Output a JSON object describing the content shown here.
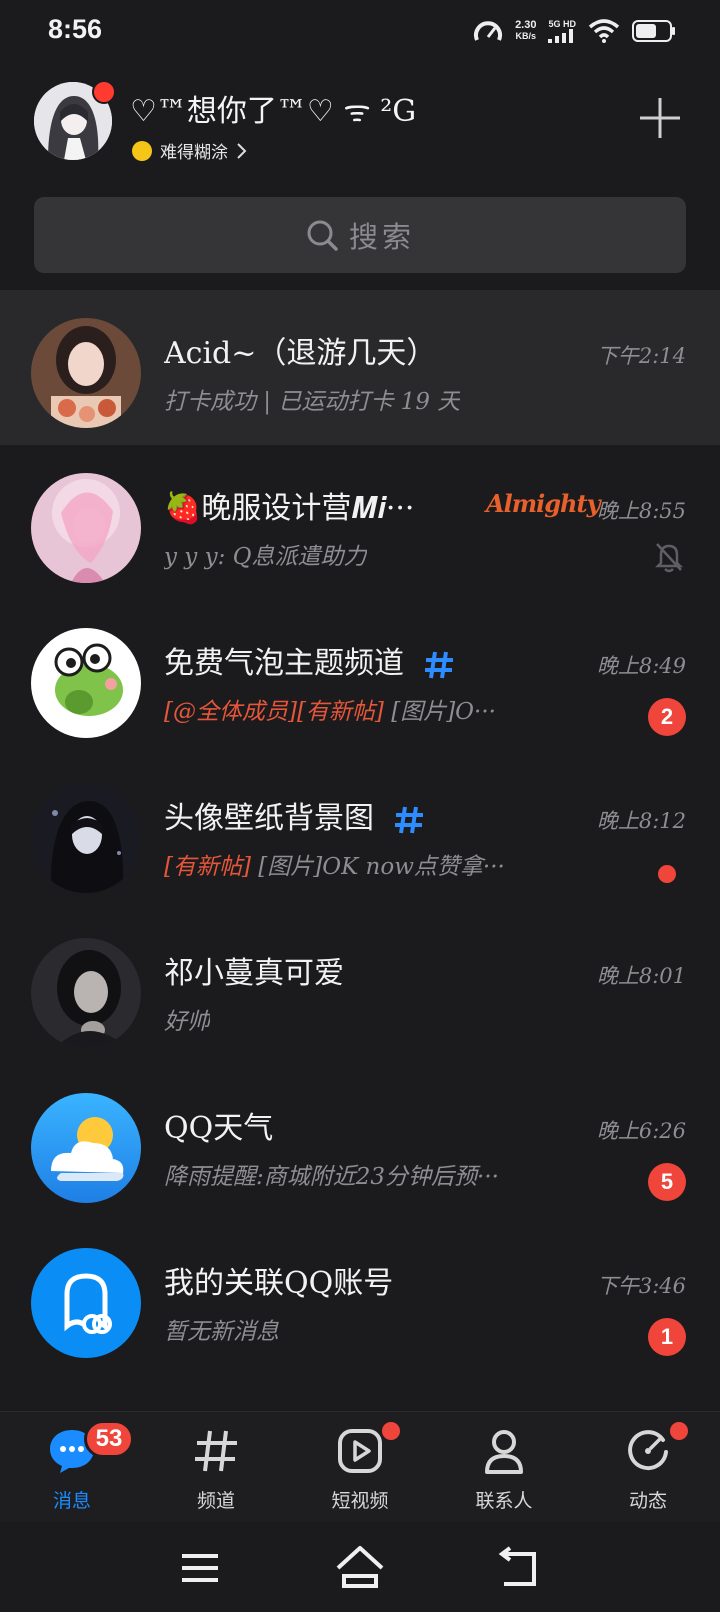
{
  "status_bar": {
    "time": "8:56",
    "net_speed": "2.30",
    "net_unit": "KB/s",
    "net_type": "5G HD"
  },
  "header": {
    "nickname": "♡™想你了™♡ ᯤ ²G",
    "status_text": "难得糊涂"
  },
  "search": {
    "label": "搜索"
  },
  "chats": [
    {
      "name": "Acid~（退游几天）",
      "time": "下午2:14",
      "preview": "打卡成功 | 已运动打卡 19 天"
    },
    {
      "name": "🍓晚服设计营𝑴𝒊···",
      "tag": "Almighty",
      "time": "晚上8:55",
      "preview": "y y y: Q息派遣助力"
    },
    {
      "name": "免费气泡主题频道",
      "time": "晚上8:49",
      "preview_hl": "[@全体成员][有新帖]",
      "preview": " [图片]O···",
      "badge": "2"
    },
    {
      "name": "头像壁纸背景图",
      "time": "晚上8:12",
      "preview_hl": "[有新帖]",
      "preview": " [图片]OK now点赞拿···"
    },
    {
      "name": "祁小蔓真可爱",
      "time": "晚上8:01",
      "preview": "好帅"
    },
    {
      "name": "QQ天气",
      "time": "晚上6:26",
      "preview": "降雨提醒:商城附近23分钟后预···",
      "badge": "5"
    },
    {
      "name": "我的关联QQ账号",
      "time": "下午3:46",
      "preview": "暂无新消息",
      "badge": "1"
    }
  ],
  "tabs": [
    {
      "label": "消息",
      "badge": "53"
    },
    {
      "label": "频道"
    },
    {
      "label": "短视频"
    },
    {
      "label": "联系人"
    },
    {
      "label": "动态"
    }
  ],
  "colors": {
    "accent": "#1a8cff",
    "badge": "#f0453b",
    "background": "#1b1b1d"
  }
}
